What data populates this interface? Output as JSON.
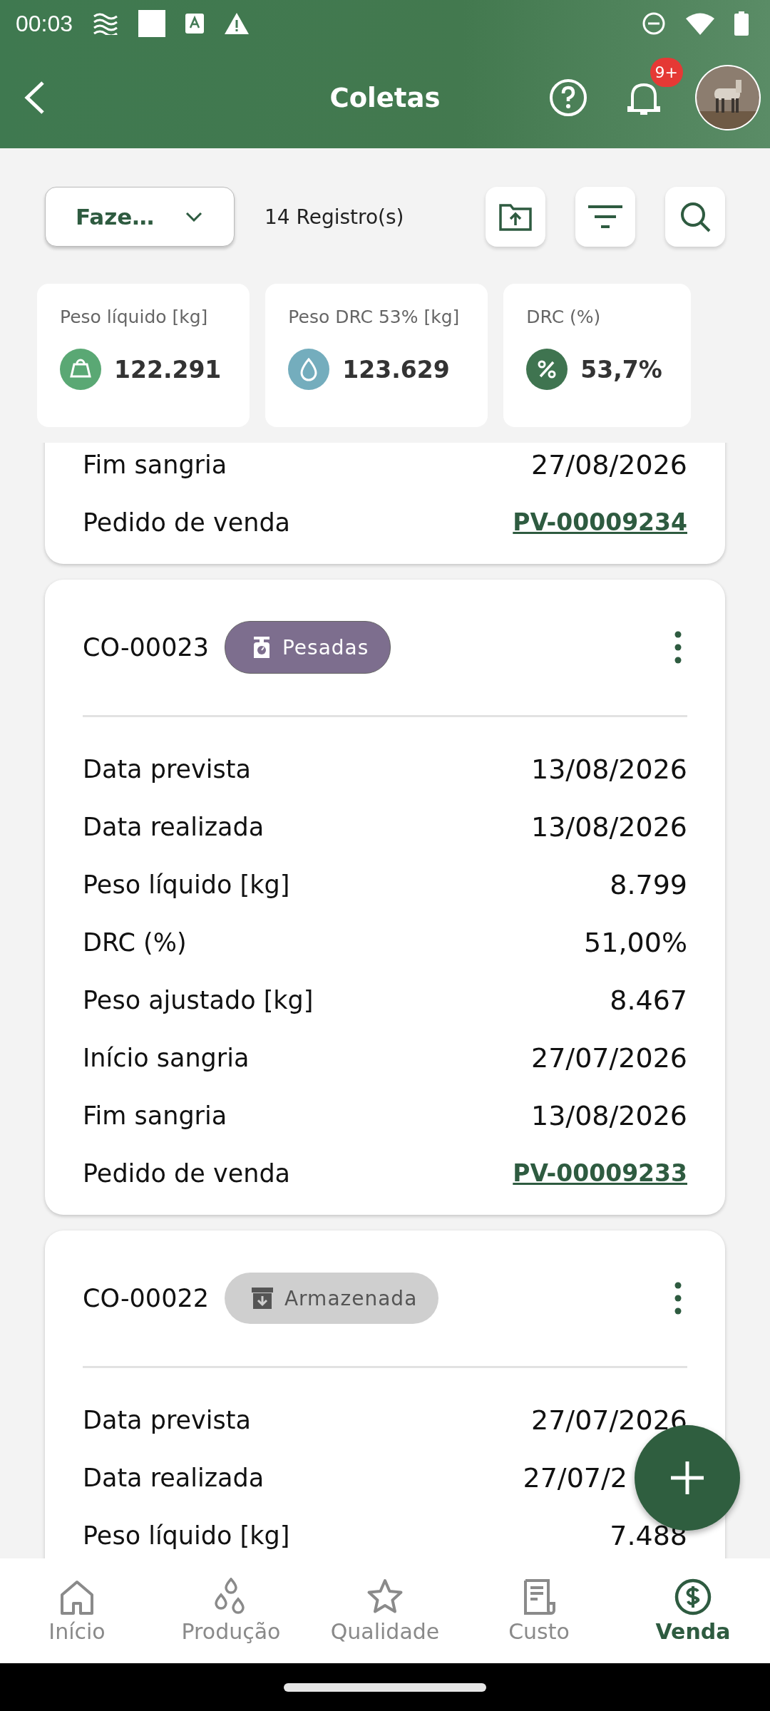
{
  "status_bar": {
    "time": "00:03"
  },
  "header": {
    "title": "Coletas",
    "notification_count": "9+"
  },
  "toolbar": {
    "farm_select": "Faze…",
    "record_count": "14 Registro(s)"
  },
  "stats": [
    {
      "label": "Peso líquido [kg]",
      "value": "122.291",
      "kind": "weight"
    },
    {
      "label": "Peso DRC 53% [kg]",
      "value": "123.629",
      "kind": "drop"
    },
    {
      "label": "DRC (%)",
      "value": "53,7%",
      "kind": "percent"
    }
  ],
  "cards": [
    {
      "fields": [
        {
          "label": "Fim sangria",
          "value": "27/08/2026",
          "kind": "text"
        },
        {
          "label": "Pedido de venda",
          "value": "PV-00009234",
          "kind": "link"
        }
      ]
    },
    {
      "code": "CO-00023",
      "status": {
        "label": "Pesadas",
        "kind": "weighed"
      },
      "fields": [
        {
          "label": "Data prevista",
          "value": "13/08/2026",
          "kind": "text"
        },
        {
          "label": "Data realizada",
          "value": "13/08/2026",
          "kind": "text"
        },
        {
          "label": "Peso líquido [kg]",
          "value": "8.799",
          "kind": "text"
        },
        {
          "label": "DRC (%)",
          "value": "51,00%",
          "kind": "text"
        },
        {
          "label": "Peso ajustado [kg]",
          "value": "8.467",
          "kind": "text"
        },
        {
          "label": "Início sangria",
          "value": "27/07/2026",
          "kind": "text"
        },
        {
          "label": "Fim sangria",
          "value": "13/08/2026",
          "kind": "text"
        },
        {
          "label": "Pedido de venda",
          "value": "PV-00009233",
          "kind": "link"
        }
      ]
    },
    {
      "code": "CO-00022",
      "status": {
        "label": "Armazenada",
        "kind": "stored"
      },
      "fields": [
        {
          "label": "Data prevista",
          "value": "27/07/2026",
          "kind": "text"
        },
        {
          "label": "Data realizada",
          "value": "27/07/2",
          "kind": "covered"
        },
        {
          "label": "Peso líquido [kg]",
          "value": "7.488",
          "kind": "text"
        }
      ]
    }
  ],
  "bottom_nav": [
    {
      "label": "Início",
      "kind": "home",
      "selected": false
    },
    {
      "label": "Produção",
      "kind": "drops",
      "selected": false
    },
    {
      "label": "Qualidade",
      "kind": "star",
      "selected": false
    },
    {
      "label": "Custo",
      "kind": "receipt",
      "selected": false
    },
    {
      "label": "Venda",
      "kind": "dollar",
      "selected": true
    }
  ]
}
